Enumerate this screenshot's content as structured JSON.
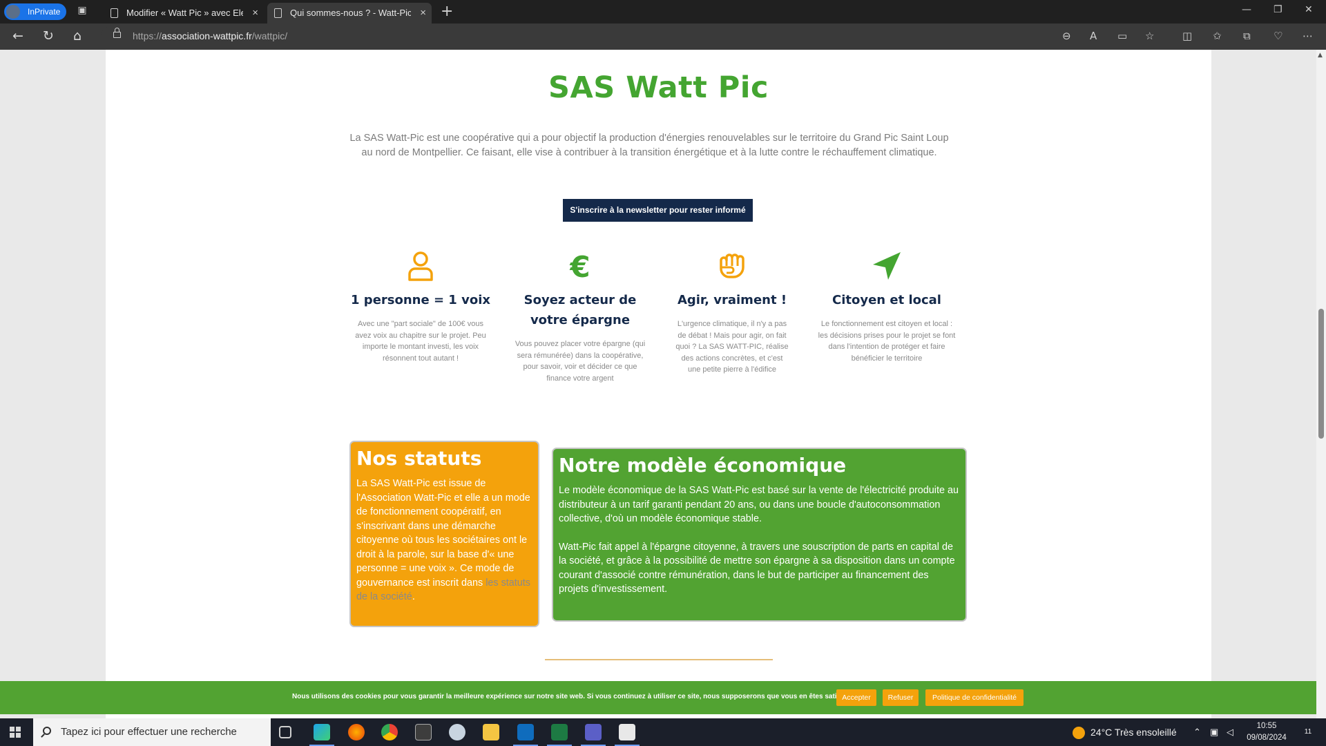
{
  "browser": {
    "inprivate_label": "InPrivate",
    "tabs": [
      {
        "label": "Modifier « Watt Pic » avec Eleme"
      },
      {
        "label": "Qui sommes-nous ? - Watt-Pic"
      }
    ],
    "url_scheme": "https://",
    "url_host": "association-wattpic.fr",
    "url_path": "/wattpic/"
  },
  "page": {
    "title": "SAS Watt Pic",
    "intro": "La SAS Watt-Pic est une coopérative qui a pour objectif la production d'énergies renouvelables sur le territoire du Grand Pic Saint Loup au nord de Montpellier. Ce faisant, elle vise à contribuer à la transition énergétique et à la lutte contre le réchauffement climatique.",
    "newsletter_button": "S'inscrire à la newsletter pour rester informé",
    "features": [
      {
        "icon": "user-icon",
        "title": "1 personne = 1 voix",
        "desc": "Avec une \"part sociale\" de 100€ vous avez voix au chapitre sur le projet. Peu importe le montant investi, les voix résonnent tout autant !"
      },
      {
        "icon": "euro-icon",
        "title": "Soyez acteur de votre épargne",
        "desc": "Vous pouvez placer votre épargne (qui sera rémunérée) dans la coopérative, pour savoir, voir et décider ce que finance votre argent"
      },
      {
        "icon": "fist-icon",
        "title": "Agir, vraiment !",
        "desc": "L'urgence climatique, il n'y a pas de débat ! Mais pour agir, on fait quoi ? La SAS WATT-PIC, réalise des actions concrètes, et c'est une petite pierre à l'édifice"
      },
      {
        "icon": "paper-plane-icon",
        "title": "Citoyen et local",
        "desc": "Le fonctionnement est citoyen et local : les décisions prises pour le projet se font dans l'intention de protéger et faire bénéficier le territoire"
      }
    ],
    "statuts": {
      "title": "Nos statuts",
      "text": "La SAS Watt-Pic est issue de l'Association Watt-Pic et elle a un mode de fonctionnement coopératif, en s'inscrivant dans une démarche citoyenne où tous les sociétaires ont le droit à la parole, sur la base d'« une personne = une voix ». Ce mode de gouvernance est inscrit dans ",
      "link": "les statuts de la société",
      "after_link": "."
    },
    "modele": {
      "title": "Notre modèle économique",
      "p1": "Le modèle économique de la SAS Watt-Pic est basé sur la vente de l'électricité produite au distributeur à un tarif garanti pendant 20 ans, ou dans une boucle d'autoconsommation collective, d'où un modèle économique stable.",
      "p2": "Watt-Pic fait appel à l'épargne citoyenne, à travers une souscription de parts en capital de la société, et grâce à la possibilité de mettre son épargne à sa disposition dans un compte courant d'associé contre rémunération, dans le but de participer au financement des projets d'investissement."
    },
    "cookie": {
      "text": "Nous utilisons des cookies pour vous garantir la meilleure expérience sur notre site web. Si vous continuez à utiliser ce site, nous supposerons que vous en êtes satisfait.",
      "accept": "Accepter",
      "refuse": "Refuser",
      "policy": "Politique de confidentialité"
    }
  },
  "taskbar": {
    "search_placeholder": "Tapez ici pour effectuer une recherche",
    "weather": "24°C  Très ensoleillé",
    "time": "10:55",
    "date": "09/08/2024",
    "notification_count": "11"
  },
  "colors": {
    "green": "#44a531",
    "orange": "#f4a20c",
    "navy": "#14294a"
  }
}
